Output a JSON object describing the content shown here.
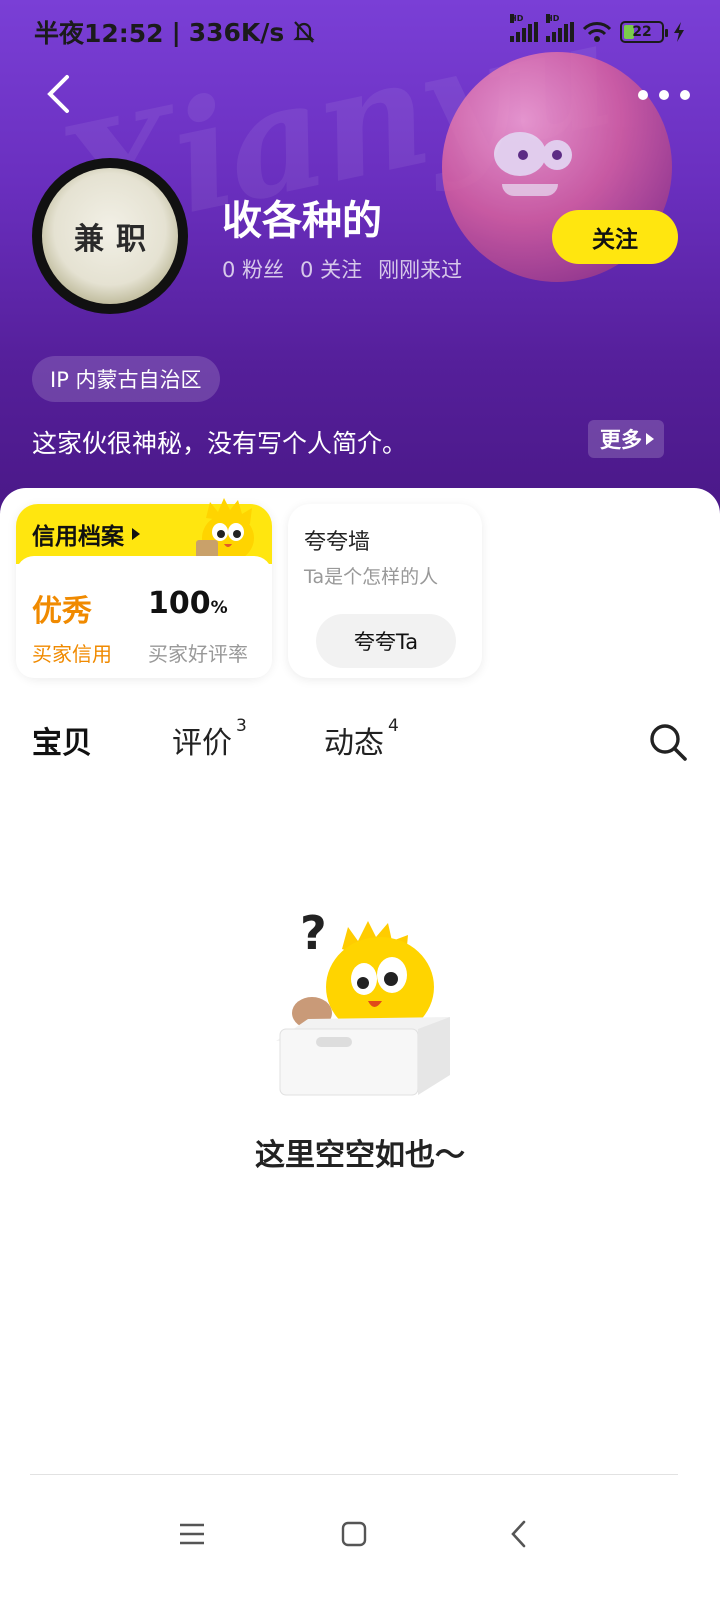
{
  "status_bar": {
    "time": "半夜12:52",
    "separator": "|",
    "speed": "336K/s",
    "battery": "22"
  },
  "profile": {
    "avatar_text": [
      "兼",
      "职"
    ],
    "name": "收各种的",
    "fans": "0 粉丝",
    "following": "0 关注",
    "last_seen": "刚刚来过",
    "follow_label": "关注",
    "ip_location": "IP 内蒙古自治区",
    "bio": "这家伙很神秘，没有写个人简介。",
    "more_label": "更多"
  },
  "credit": {
    "title": "信用档案",
    "rating_value": "优秀",
    "rating_label": "买家信用",
    "good_rate_value": "100",
    "good_rate_unit": "%",
    "good_rate_label": "买家好评率"
  },
  "praise_wall": {
    "title": "夸夸墙",
    "subtitle": "Ta是个怎样的人",
    "button": "夸夸Ta"
  },
  "tabs": [
    {
      "label": "宝贝",
      "count": ""
    },
    {
      "label": "评价",
      "count": "3"
    },
    {
      "label": "动态",
      "count": "4"
    }
  ],
  "empty_state": {
    "text": "这里空空如也～"
  },
  "colors": {
    "accent_yellow": "#ffe60f",
    "header_purple": "#6a2fbf",
    "credit_orange": "#f08a00"
  }
}
